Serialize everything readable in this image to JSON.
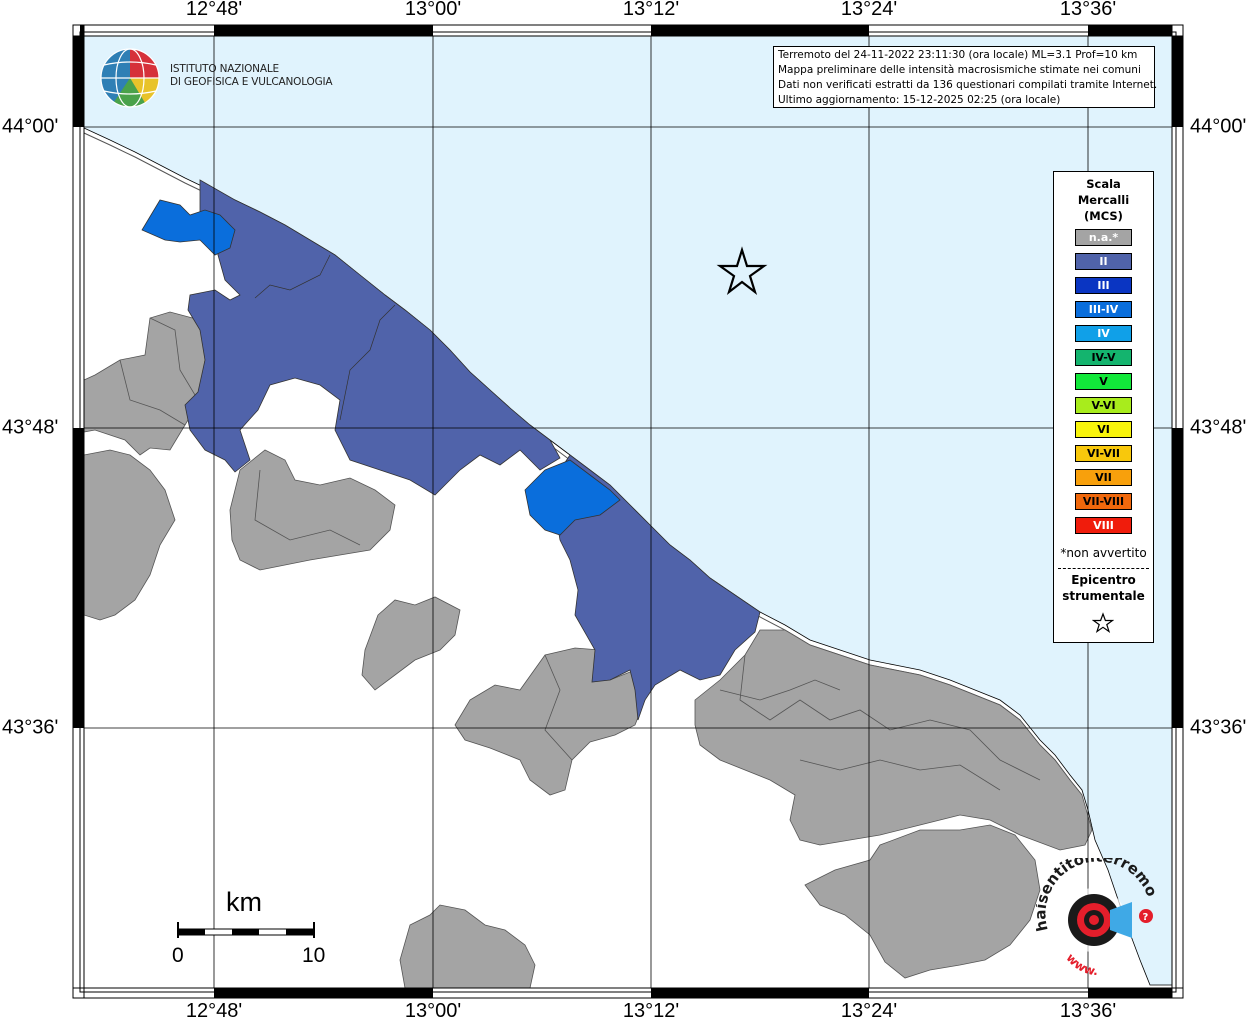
{
  "map": {
    "info_lines": [
      "Terremoto del 24-11-2022 23:11:30 (ora locale) ML=3.1 Prof=10 km",
      "Mappa preliminare delle intensità macrosismiche stimate nei comuni",
      "Dati non verificati estratti da 136 questionari compilati tramite Internet.",
      "Ultimo aggiornamento: 15-12-2025 02:25 (ora locale)"
    ],
    "logo_lines": [
      "ISTITUTO NAZIONALE",
      "DI GEOFISICA E VULCANOLOGIA"
    ],
    "longitude_labels": [
      "12°48'",
      "13°00'",
      "13°12'",
      "13°24'",
      "13°36'"
    ],
    "latitude_labels": [
      "44°00'",
      "43°48'",
      "43°36'"
    ],
    "legend": {
      "title_lines": [
        "Scala",
        "Mercalli",
        "(MCS)"
      ],
      "items": [
        {
          "label": "n.a.*",
          "color": "#a4a4a4",
          "text_color": "#ffffff"
        },
        {
          "label": "II",
          "color": "#5063aa",
          "text_color": "#ffffff"
        },
        {
          "label": "III",
          "color": "#0a35c2",
          "text_color": "#ffffff"
        },
        {
          "label": "III-IV",
          "color": "#0a6edc",
          "text_color": "#ffffff"
        },
        {
          "label": "IV",
          "color": "#10a0e8",
          "text_color": "#ffffff"
        },
        {
          "label": "IV-V",
          "color": "#14b46e",
          "text_color": "#000000"
        },
        {
          "label": "V",
          "color": "#12e83a",
          "text_color": "#000000"
        },
        {
          "label": "V-VI",
          "color": "#a8ec1c",
          "text_color": "#000000"
        },
        {
          "label": "VI",
          "color": "#f8f40c",
          "text_color": "#000000"
        },
        {
          "label": "VI-VII",
          "color": "#f8c80c",
          "text_color": "#000000"
        },
        {
          "label": "VII",
          "color": "#f8a00c",
          "text_color": "#000000"
        },
        {
          "label": "VII-VIII",
          "color": "#f0680c",
          "text_color": "#000000"
        },
        {
          "label": "VIII",
          "color": "#f01c0c",
          "text_color": "#ffffff"
        }
      ],
      "note": "*non avvertito",
      "epicenter_lines": [
        "Epicentro",
        "strumentale"
      ]
    },
    "scale_bar": {
      "title": "km",
      "min_label": "0",
      "max_label": "10"
    },
    "colors": {
      "sea": "#e0f3fd",
      "land_white": "#ffffff",
      "na_gray": "#a4a4a4",
      "intensity_ii": "#5063aa",
      "intensity_iii_iv": "#0a6edc"
    },
    "partner_logo": {
      "text": "haisentitoilterremoto.it",
      "prefix": "www."
    }
  }
}
